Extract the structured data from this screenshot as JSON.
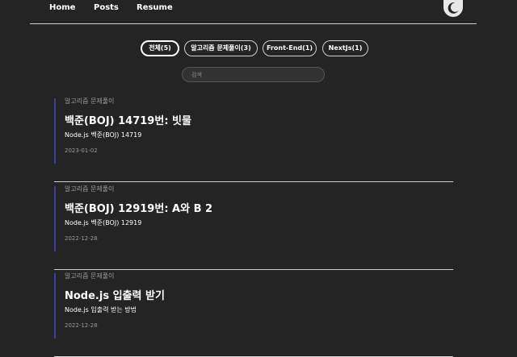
{
  "nav": {
    "links": [
      {
        "label": "Home"
      },
      {
        "label": "Posts"
      },
      {
        "label": "Resume"
      }
    ],
    "theme_icon": "moon-icon"
  },
  "categories": [
    {
      "label": "전체(5)",
      "active": true
    },
    {
      "label": "알고리즘 문제풀이(3)",
      "active": false
    },
    {
      "label": "Front-End(1)",
      "active": false
    },
    {
      "label": "NextJs(1)",
      "active": false
    }
  ],
  "search": {
    "placeholder": "검색",
    "value": ""
  },
  "posts": [
    {
      "category": "알고리즘 문제풀이",
      "title": "백준(BOJ) 14719번: 빗물",
      "description": "Node.js 백준(BOJ) 14719",
      "date": "2023-01-02"
    },
    {
      "category": "알고리즘 문제풀이",
      "title": "백준(BOJ) 12919번: A와 B 2",
      "description": "Node.js 백준(BOJ) 12919",
      "date": "2022-12-28"
    },
    {
      "category": "알고리즘 문제풀이",
      "title": "Node.js 입출력 받기",
      "description": "Node.js 입출력 받는 방법",
      "date": "2022-12-28"
    }
  ],
  "colors": {
    "background": "#242424",
    "accent_bar": "#3a3fa8",
    "divider": "#cfcfcf",
    "muted_text": "#9b9b9b"
  }
}
